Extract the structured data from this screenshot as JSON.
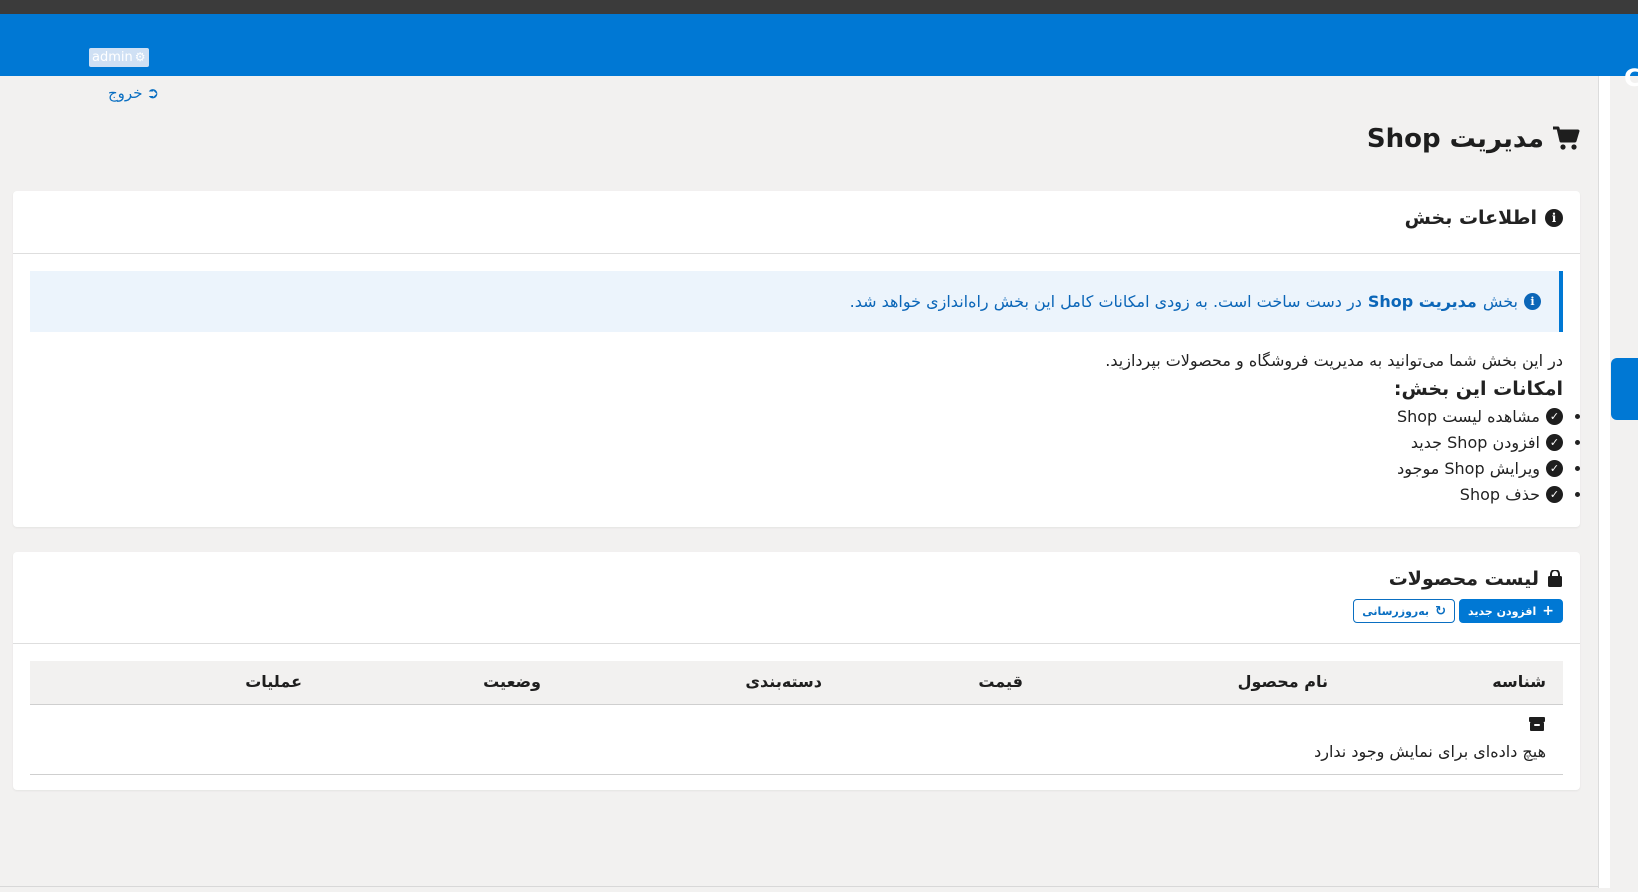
{
  "header": {
    "user_label": "admin",
    "logout_label": "خروج"
  },
  "page": {
    "title": "مدیریت Shop"
  },
  "info_card": {
    "title": "اطلاعات بخش",
    "alert_prefix": "بخش",
    "alert_bold": "مدیریت Shop",
    "alert_suffix": "در دست ساخت است. به زودی امکانات کامل این بخش راه‌اندازی خواهد شد.",
    "description": "در این بخش شما می‌توانید به مدیریت فروشگاه و محصولات بپردازید.",
    "features_title": "امکانات این بخش:",
    "features": [
      "مشاهده لیست Shop",
      "افزودن Shop جدید",
      "ویرایش Shop موجود",
      "حذف Shop"
    ]
  },
  "products_card": {
    "title": "لیست محصولات",
    "add_label": "افزودن جدید",
    "refresh_label": "به‌روزرسانی",
    "columns": [
      "شناسه",
      "نام محصول",
      "قیمت",
      "دسته‌بندی",
      "وضعیت",
      "عملیات"
    ],
    "empty_text": "هیچ داده‌ای برای نمایش وجود ندارد"
  },
  "colors": {
    "primary": "#0078d4",
    "topstrip": "#3b3b3b",
    "background": "#f2f1f0",
    "alert_bg": "#ecf4fc"
  }
}
